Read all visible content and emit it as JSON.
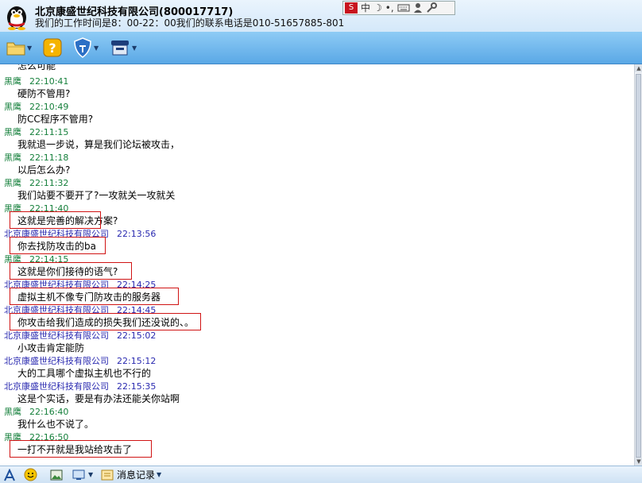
{
  "header": {
    "title": "北京康盛世纪科技有限公司(800017717)",
    "notice": "我们的工作时间是8：00-22：00我们的联系电话是010-51657885-801",
    "ime": {
      "logo": "S",
      "mode": "中",
      "moon": "☽",
      "punct": "•,"
    }
  },
  "toolbar": {
    "icons": [
      "folder-icon",
      "help-icon",
      "shield-icon",
      "computer-icon"
    ]
  },
  "chat": {
    "partial_top": "怎么可能",
    "messages": [
      {
        "sender": "黑鹰",
        "time": "22:10:41",
        "text": "硬防不管用?"
      },
      {
        "sender": "黑鹰",
        "time": "22:10:49",
        "text": "防CC程序不管用?"
      },
      {
        "sender": "黑鹰",
        "time": "22:11:15",
        "text": "我就退一步说，算是我们论坛被攻击，"
      },
      {
        "sender": "黑鹰",
        "time": "22:11:18",
        "text": "以后怎么办?"
      },
      {
        "sender": "黑鹰",
        "time": "22:11:32",
        "text": "我们站要不要开了?一攻就关一攻就关"
      },
      {
        "sender": "黑鹰",
        "time": "22:11:40",
        "text": "这就是完善的解决方案?"
      },
      {
        "sender": "北京康盛世纪科技有限公司",
        "time": "22:13:56",
        "text": "你去找防攻击的ba"
      },
      {
        "sender": "黑鹰",
        "time": "22:14:15",
        "text": "这就是你们接待的语气?"
      },
      {
        "sender": "北京康盛世纪科技有限公司",
        "time": "22:14:25",
        "text": "虚拟主机不像专门防攻击的服务器"
      },
      {
        "sender": "北京康盛世纪科技有限公司",
        "time": "22:14:45",
        "text": "你攻击给我们造成的损失我们还没说的、。"
      },
      {
        "sender": "北京康盛世纪科技有限公司",
        "time": "22:15:02",
        "text": "小攻击肯定能防"
      },
      {
        "sender": "北京康盛世纪科技有限公司",
        "time": "22:15:12",
        "text": "大的工具哪个虚拟主机也不行的"
      },
      {
        "sender": "北京康盛世纪科技有限公司",
        "time": "22:15:35",
        "text": "这是个实话，要是有办法还能关你站啊"
      },
      {
        "sender": "黑鹰",
        "time": "22:16:40",
        "text": "我什么也不说了。"
      },
      {
        "sender": "黑鹰",
        "time": "22:16:50",
        "text": "一打不开就是我站给攻击了"
      }
    ]
  },
  "bottom": {
    "history_label": "消息记录"
  },
  "colors": {
    "visitor": "#16803c",
    "company": "#2a2ab0",
    "highlight": "#d01414",
    "toolbar": "#5aa8e6"
  }
}
